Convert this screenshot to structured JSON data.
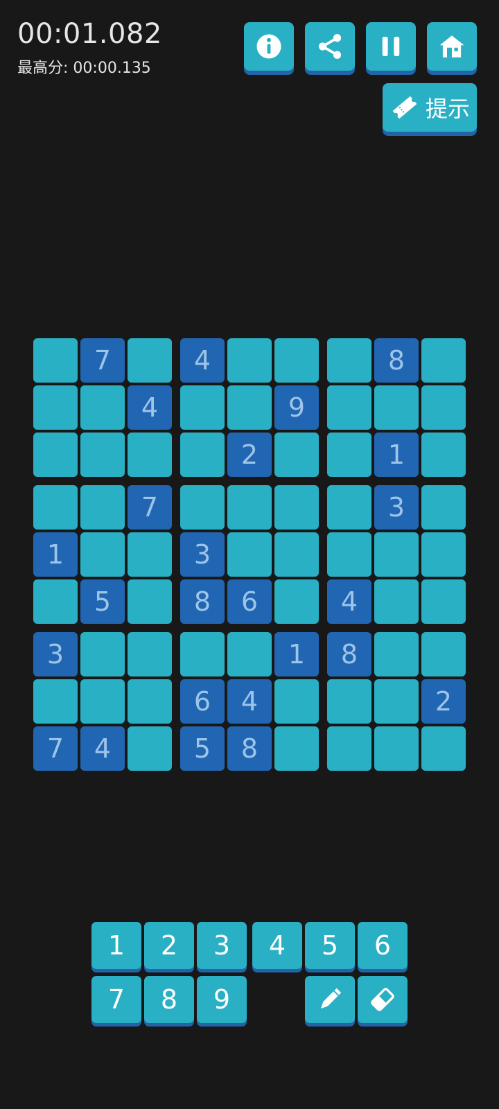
{
  "timer": {
    "elapsed": "00:01.082",
    "best_label": "最高分:",
    "best_value": "00:00.135"
  },
  "top_buttons": [
    {
      "name": "info-button",
      "icon": "info-icon"
    },
    {
      "name": "share-button",
      "icon": "share-icon"
    },
    {
      "name": "pause-button",
      "icon": "pause-icon"
    },
    {
      "name": "home-button",
      "icon": "home-icon"
    }
  ],
  "hint": {
    "label": "提示",
    "icon": "ticket-icon"
  },
  "grid": [
    [
      "",
      "7",
      "",
      "4",
      "",
      "",
      "",
      "8",
      ""
    ],
    [
      "",
      "",
      "4",
      "",
      "",
      "9",
      "",
      "",
      ""
    ],
    [
      "",
      "",
      "",
      "",
      "2",
      "",
      "",
      "1",
      ""
    ],
    [
      "",
      "",
      "7",
      "",
      "",
      "",
      "",
      "3",
      ""
    ],
    [
      "1",
      "",
      "",
      "3",
      "",
      "",
      "",
      "",
      ""
    ],
    [
      "",
      "5",
      "",
      "8",
      "6",
      "",
      "4",
      "",
      ""
    ],
    [
      "3",
      "",
      "",
      "",
      "",
      "1",
      "8",
      "",
      ""
    ],
    [
      "",
      "",
      "",
      "6",
      "4",
      "",
      "",
      "",
      "2"
    ],
    [
      "7",
      "4",
      "",
      "5",
      "8",
      "",
      "",
      "",
      ""
    ]
  ],
  "number_pad": [
    "1",
    "2",
    "3",
    "4",
    "5",
    "6",
    "7",
    "8",
    "9"
  ],
  "tools": [
    {
      "name": "pencil-button",
      "icon": "pencil-icon"
    },
    {
      "name": "eraser-button",
      "icon": "eraser-icon"
    }
  ],
  "colors": {
    "empty_cell": "#2ab0c4",
    "given_cell": "#2166b3",
    "given_digit": "#9ec4e8",
    "background": "#181818"
  }
}
